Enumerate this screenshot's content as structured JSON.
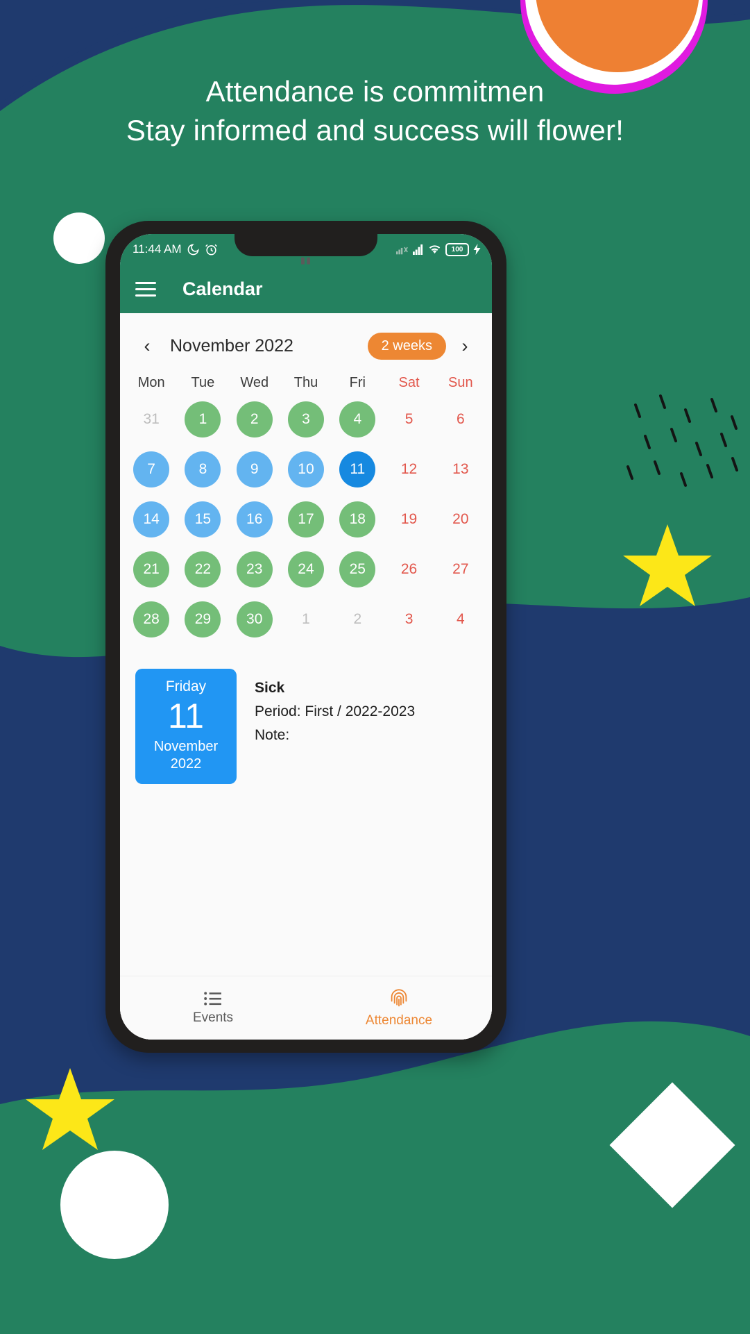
{
  "poster": {
    "headline_line1": "Attendance is commitmen",
    "headline_line2": "Stay informed and success will flower!",
    "colors": {
      "navy": "#1F3A6E",
      "green": "#24815F",
      "orange": "#EE8033",
      "yellow": "#FCE718",
      "white": "#FFFFFF",
      "magenta": "#E01AE0"
    }
  },
  "statusbar": {
    "time": "11:44 AM",
    "moon_icon": "moon-icon",
    "alarm_icon": "alarm-icon",
    "signal1_icon": "signal-weak-icon",
    "signal2_icon": "signal-full-icon",
    "wifi_icon": "wifi-icon",
    "battery_level": "100",
    "charging_icon": "charging-bolt-icon"
  },
  "appbar": {
    "menu_icon": "hamburger-menu-icon",
    "title": "Calendar"
  },
  "calendar": {
    "prev_icon": "chevron-left-icon",
    "next_icon": "chevron-right-icon",
    "month_label": "November 2022",
    "range_badge": "2 weeks",
    "weekdays": [
      {
        "label": "Mon",
        "weekend": false
      },
      {
        "label": "Tue",
        "weekend": false
      },
      {
        "label": "Wed",
        "weekend": false
      },
      {
        "label": "Thu",
        "weekend": false
      },
      {
        "label": "Fri",
        "weekend": false
      },
      {
        "label": "Sat",
        "weekend": true
      },
      {
        "label": "Sun",
        "weekend": true
      }
    ],
    "weeks": [
      [
        {
          "day": "31",
          "style": "out"
        },
        {
          "day": "1",
          "style": "green"
        },
        {
          "day": "2",
          "style": "green"
        },
        {
          "day": "3",
          "style": "green"
        },
        {
          "day": "4",
          "style": "green"
        },
        {
          "day": "5",
          "style": "weekend"
        },
        {
          "day": "6",
          "style": "weekend"
        }
      ],
      [
        {
          "day": "7",
          "style": "blue"
        },
        {
          "day": "8",
          "style": "blue"
        },
        {
          "day": "9",
          "style": "blue"
        },
        {
          "day": "10",
          "style": "blue"
        },
        {
          "day": "11",
          "style": "selected"
        },
        {
          "day": "12",
          "style": "weekend"
        },
        {
          "day": "13",
          "style": "weekend"
        }
      ],
      [
        {
          "day": "14",
          "style": "blue"
        },
        {
          "day": "15",
          "style": "blue"
        },
        {
          "day": "16",
          "style": "blue"
        },
        {
          "day": "17",
          "style": "green"
        },
        {
          "day": "18",
          "style": "green"
        },
        {
          "day": "19",
          "style": "weekend"
        },
        {
          "day": "20",
          "style": "weekend"
        }
      ],
      [
        {
          "day": "21",
          "style": "green"
        },
        {
          "day": "22",
          "style": "green"
        },
        {
          "day": "23",
          "style": "green"
        },
        {
          "day": "24",
          "style": "green"
        },
        {
          "day": "25",
          "style": "green"
        },
        {
          "day": "26",
          "style": "weekend"
        },
        {
          "day": "27",
          "style": "weekend"
        }
      ],
      [
        {
          "day": "28",
          "style": "green"
        },
        {
          "day": "29",
          "style": "green"
        },
        {
          "day": "30",
          "style": "green"
        },
        {
          "day": "1",
          "style": "out"
        },
        {
          "day": "2",
          "style": "out"
        },
        {
          "day": "3",
          "style": "weekend"
        },
        {
          "day": "4",
          "style": "weekend"
        }
      ]
    ]
  },
  "detail": {
    "weekday": "Friday",
    "day": "11",
    "month": "November",
    "year": "2022",
    "status": "Sick",
    "period": "Period: First / 2022-2023",
    "note": "Note:"
  },
  "bottomnav": {
    "events_icon": "list-icon",
    "events_label": "Events",
    "attendance_icon": "fingerprint-icon",
    "attendance_label": "Attendance"
  }
}
